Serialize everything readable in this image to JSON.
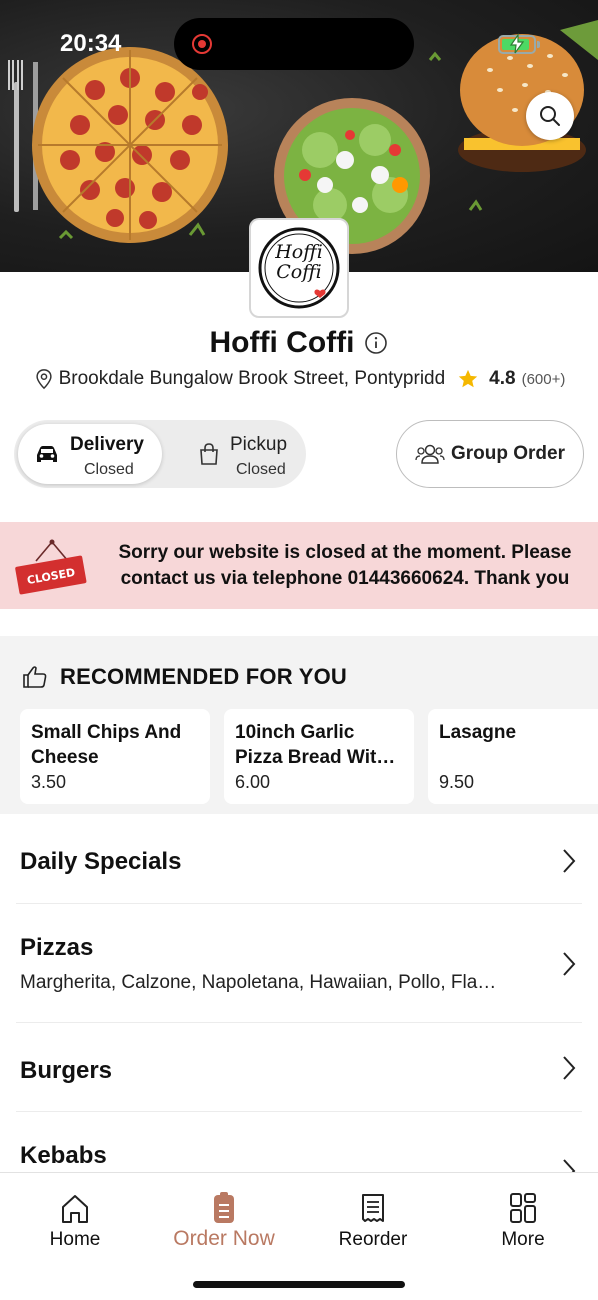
{
  "status_bar": {
    "time": "20:34",
    "battery_level": 0.9
  },
  "hero": {
    "search_icon": "search-icon"
  },
  "logo": {
    "text_line1": "Hoffi",
    "text_line2": "Coffi"
  },
  "restaurant": {
    "name": "Hoffi Coffi",
    "address": "Brookdale Bungalow Brook Street, Pontypridd",
    "rating": "4.8",
    "rating_count": "(600+)"
  },
  "order_mode": {
    "delivery": {
      "label": "Delivery",
      "status": "Closed"
    },
    "pickup": {
      "label": "Pickup",
      "status": "Closed"
    },
    "group_order_label": "Group Order"
  },
  "closed_notice": {
    "sign_text": "CLOSED",
    "message": "Sorry our website is closed at the moment. Please contact us via telephone 01443660624. Thank you"
  },
  "recommended": {
    "title": "RECOMMENDED FOR YOU",
    "items": [
      {
        "name": "Small Chips And Cheese",
        "price": "3.50"
      },
      {
        "name": "10inch Garlic Pizza Bread Wit…",
        "price": "6.00"
      },
      {
        "name": "Lasagne",
        "price": "9.50"
      }
    ]
  },
  "categories": [
    {
      "name": "Daily Specials",
      "description": ""
    },
    {
      "name": "Pizzas",
      "description": "Margherita, Calzone, Napoletana, Hawaiian, Pollo, Fla…"
    },
    {
      "name": "Burgers",
      "description": ""
    },
    {
      "name": "Kebabs",
      "description": ""
    }
  ],
  "tabbar": {
    "items": [
      {
        "label": "Home",
        "icon": "home-icon"
      },
      {
        "label": "Order Now",
        "icon": "order-icon"
      },
      {
        "label": "Reorder",
        "icon": "receipt-icon"
      },
      {
        "label": "More",
        "icon": "grid-icon"
      }
    ],
    "active_color": "#b97962"
  },
  "colors": {
    "closed_banner_bg": "#f7d7d8",
    "closed_sign": "#d32f2f",
    "star": "#f5b800"
  }
}
